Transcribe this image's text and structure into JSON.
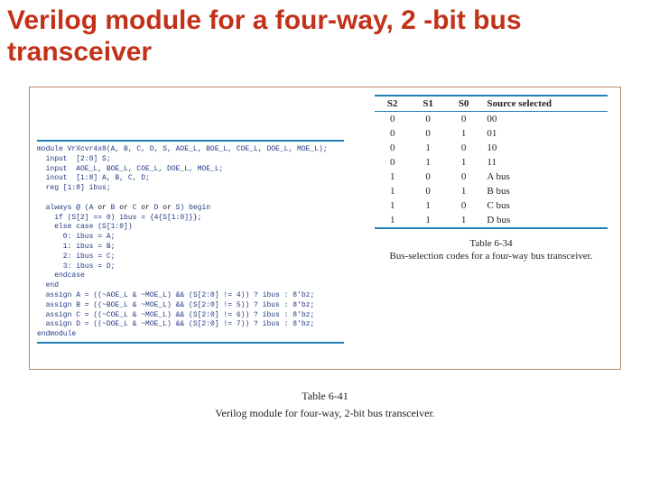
{
  "title": "Verilog module for a four-way, 2 -bit bus transceiver",
  "code": {
    "l1": "module VrXcvr4x8(A, B, C, D, S, AOE_L, BOE_L, COE_L, DOE_L, MOE_L);",
    "l2": "  input  [2:0] S;",
    "l3": "  input  AOE_L, BOE_L, COE_L, DOE_L, MOE_L;",
    "l4": "  inout  [1:8] A, B, C, D;",
    "l5": "  reg [1:8] ibus;",
    "l6a": "  always @ (A ",
    "l6b": " B ",
    "l6c": " C ",
    "l6d": " D ",
    "l6e": " S) begin",
    "or": "or",
    "l7": "    if (S[2] == 0) ibus = {4{S[1:0]}};",
    "l8": "    else case (S[1:0])",
    "l9": "      0: ibus = A;",
    "l10": "      1: ibus = B;",
    "l11": "      2: ibus = C;",
    "l12": "      3: ibus = D;",
    "l13": "    endcase",
    "l14": "  end",
    "l15": "  assign A = ((~AOE_L & ~MOE_L) && (S[2:0] != 4)) ? ibus : 8'bz;",
    "l16": "  assign B = ((~BOE_L & ~MOE_L) && (S[2:0] != 5)) ? ibus : 8'bz;",
    "l17": "  assign C = ((~COE_L & ~MOE_L) && (S[2:0] != 6)) ? ibus : 8'bz;",
    "l18": "  assign D = ((~DOE_L & ~MOE_L) && (S[2:0] != 7)) ? ibus : 8'bz;",
    "l19": "endmodule"
  },
  "table34": {
    "headers": {
      "c0": "S2",
      "c1": "S1",
      "c2": "S0",
      "c3": "Source selected"
    },
    "rows": [
      {
        "c0": "0",
        "c1": "0",
        "c2": "0",
        "c3": "00"
      },
      {
        "c0": "0",
        "c1": "0",
        "c2": "1",
        "c3": "01"
      },
      {
        "c0": "0",
        "c1": "1",
        "c2": "0",
        "c3": "10"
      },
      {
        "c0": "0",
        "c1": "1",
        "c2": "1",
        "c3": "11"
      },
      {
        "c0": "1",
        "c1": "0",
        "c2": "0",
        "c3": "A bus"
      },
      {
        "c0": "1",
        "c1": "0",
        "c2": "1",
        "c3": "B bus"
      },
      {
        "c0": "1",
        "c1": "1",
        "c2": "0",
        "c3": "C bus"
      },
      {
        "c0": "1",
        "c1": "1",
        "c2": "1",
        "c3": "D bus"
      }
    ],
    "caption": "Table 6-34",
    "desc": "Bus-selection codes for a four-way bus transceiver."
  },
  "table41": {
    "caption": "Table 6-41",
    "desc": "Verilog module for four-way, 2-bit bus transceiver."
  }
}
